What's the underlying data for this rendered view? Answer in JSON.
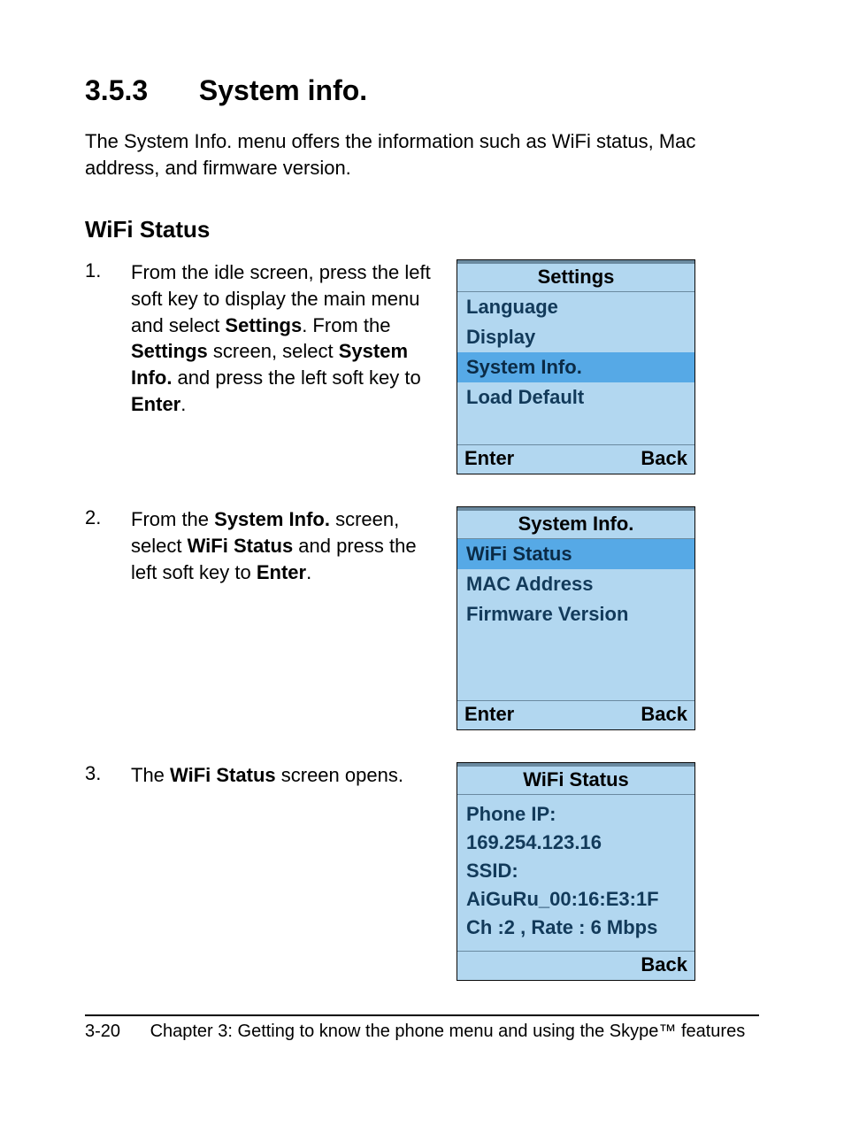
{
  "heading": {
    "num": "3.5.3",
    "title": "System info."
  },
  "intro": "The System Info. menu offers the information such as WiFi status, Mac address, and firmware version.",
  "subheading": "WiFi Status",
  "steps": [
    {
      "num": "1.",
      "pre": "From the idle screen, press the left soft key to display the main menu and select ",
      "b1": "Settings",
      "mid1": ". From the ",
      "b2": "Settings",
      "mid2": " screen, select ",
      "b3": "System Info.",
      "mid3": " and press the left soft key to ",
      "b4": "Enter",
      "post": "."
    },
    {
      "num": "2.",
      "pre": "From the ",
      "b1": "System Info.",
      "mid1": " screen, select ",
      "b2": "WiFi Status",
      "mid2": " and press the left soft key to ",
      "b3": "Enter",
      "post": "."
    },
    {
      "num": "3.",
      "pre": "The ",
      "b1": "WiFi Status",
      "post": " screen opens."
    }
  ],
  "screens": {
    "settings": {
      "title": "Settings",
      "items": [
        "Language",
        "Display",
        "System Info.",
        "Load Default"
      ],
      "selectedIndex": 2,
      "left": "Enter",
      "right": "Back"
    },
    "sysinfo": {
      "title": "System Info.",
      "items": [
        "WiFi Status",
        "MAC Address",
        "Firmware Version"
      ],
      "selectedIndex": 0,
      "left": "Enter",
      "right": "Back"
    },
    "wifi": {
      "title": "WiFi Status",
      "lines": [
        "Phone IP:",
        "169.254.123.16",
        "SSID:",
        "AiGuRu_00:16:E3:1F",
        "Ch :2 , Rate : 6 Mbps"
      ],
      "left": "",
      "right": "Back"
    }
  },
  "footer": {
    "page": "3-20",
    "text": "Chapter 3: Getting to know the phone menu and using the Skype™ features"
  }
}
